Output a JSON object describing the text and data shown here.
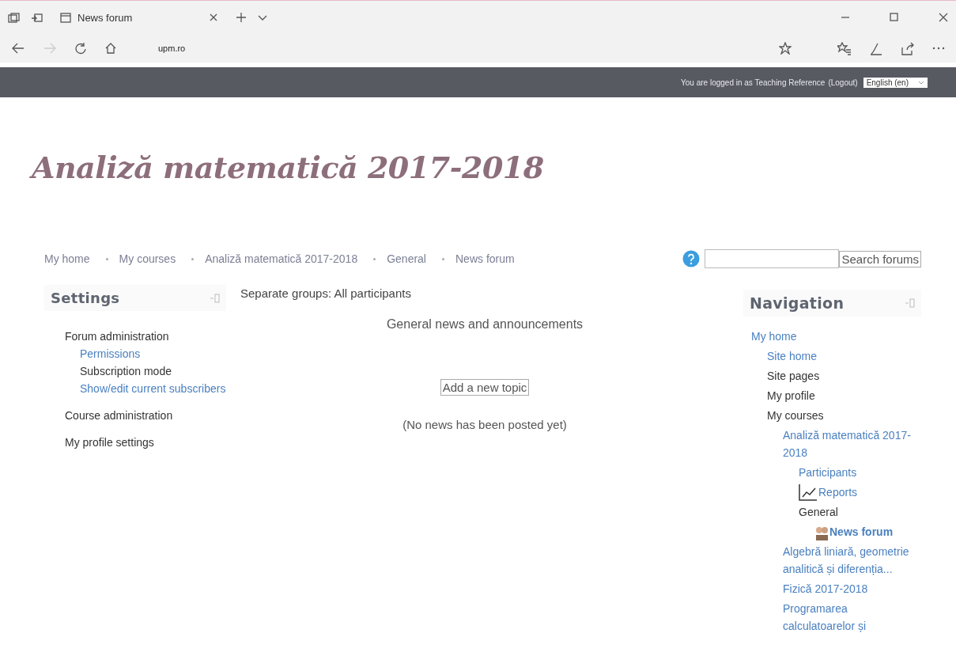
{
  "browser": {
    "tabs": [
      {
        "title": "News forum",
        "selected": true
      }
    ],
    "address": "upm.ro"
  },
  "header": {
    "login_text": "You are logged in as Teaching Reference",
    "logout": "(Logout)",
    "language": "English (en)"
  },
  "site_title": "Analiză matematică 2017-2018",
  "breadcrumb": [
    "My home",
    "My courses",
    "Analiză matematică 2017-2018",
    "General",
    "News forum"
  ],
  "search": {
    "button": "Search forums"
  },
  "settings": {
    "title": "Settings",
    "items": [
      {
        "label": "Forum administration",
        "link": false,
        "children": [
          {
            "label": "Permissions",
            "link": true
          },
          {
            "label": "Subscription mode",
            "link": false
          },
          {
            "label": "Show/edit current subscribers",
            "link": true
          }
        ]
      },
      {
        "label": "Course administration",
        "link": false
      },
      {
        "label": "My profile settings",
        "link": false
      }
    ]
  },
  "main": {
    "groups": "Separate groups: All participants",
    "forum_intro": "General news and announcements",
    "add_button": "Add a new topic",
    "empty": "(No news has been posted yet)"
  },
  "navigation": {
    "title": "Navigation",
    "items": [
      {
        "label": "My home",
        "link": true,
        "children": [
          {
            "label": "Site home",
            "link": true
          },
          {
            "label": "Site pages",
            "link": false
          },
          {
            "label": "My profile",
            "link": false
          },
          {
            "label": "My courses",
            "link": false,
            "children": [
              {
                "label": "Analiză matematică 2017-2018",
                "link": true,
                "children": [
                  {
                    "label": "Participants",
                    "link": true
                  },
                  {
                    "label": "Reports",
                    "link": true,
                    "kind": "chart"
                  },
                  {
                    "label": "General",
                    "link": false,
                    "children": [
                      {
                        "label": "News forum",
                        "link": true,
                        "current": true,
                        "kind": "forum"
                      }
                    ]
                  }
                ]
              },
              {
                "label": "Algebră liniară, geometrie analitică și diferenția...",
                "link": true
              },
              {
                "label": "Fizică 2017-2018",
                "link": true
              },
              {
                "label": "Programarea calculatoarelor și",
                "link": true
              }
            ]
          }
        ]
      }
    ]
  }
}
